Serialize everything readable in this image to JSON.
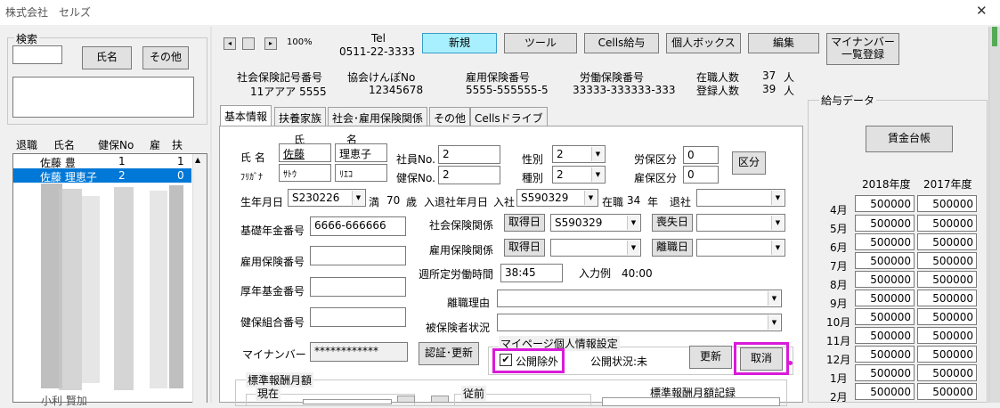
{
  "window": {
    "title": "株式会社　セルズ",
    "close_symbol": "✕"
  },
  "search": {
    "group_title": "検索",
    "input_value": "",
    "name_button": "氏名",
    "other_button": "その他",
    "results_box": ""
  },
  "employee_list": {
    "headers": [
      "退職",
      "氏名",
      "健保No",
      "扶"
    ],
    "header_extra": "雇",
    "rows": [
      {
        "name": "佐藤 豊",
        "no": "1",
        "dep": "1",
        "selected": false
      },
      {
        "name": "佐藤 理恵子",
        "no": "2",
        "dep": "0",
        "selected": true
      }
    ],
    "partial_row": "小利 賢加"
  },
  "nav": {
    "first": "◂",
    "prev": "",
    "next": "▸",
    "zoom": "100%"
  },
  "tel": {
    "label": "Tel",
    "number": "0511-22-3333"
  },
  "toolbar": {
    "new": "新規",
    "tool": "ツール",
    "cells_salary": "Cells給与",
    "personal_box": "個人ボックス",
    "edit": "編集",
    "mynumber_line1": "マイナンバー",
    "mynumber_line2": "一覧登録"
  },
  "info": {
    "social_label": "社会保険記号番号",
    "social_value": "11アアア 5555",
    "kenpo_label": "協会けんぽNo",
    "kenpo_value": "12345678",
    "koyo_label": "雇用保険番号",
    "koyo_value": "5555-555555-5",
    "rodo_label": "労働保険番号",
    "rodo_value": "33333-333333-333",
    "zaishoku_label": "在職人数",
    "zaishoku_value": "37",
    "toroku_label": "登録人数",
    "toroku_value": "39",
    "person_unit": "人"
  },
  "tabs": [
    "基本情報",
    "扶養家族",
    "社会･雇用保険関係",
    "その他",
    "Cellsドライブ"
  ],
  "form": {
    "col_sei": "氏",
    "col_mei": "名",
    "name_label": "氏 名",
    "kana_label": "ﾌﾘｶﾞﾅ",
    "sei": "佐藤",
    "mei": "理恵子",
    "sei_kana": "ｻﾄｳ",
    "mei_kana": "ﾘｴｺ",
    "employee_no_label": "社員No.",
    "employee_no": "2",
    "kenpo_no_label": "健保No.",
    "kenpo_no": "2",
    "sex_label": "性別",
    "sex": "2",
    "type_label": "種別",
    "type": "2",
    "rouho_label": "労保区分",
    "rouho": "0",
    "koho_label": "雇保区分",
    "koho": "0",
    "kubun_button": "区分",
    "birth_label": "生年月日",
    "birth": "S230226",
    "age_prefix": "満",
    "age": "70",
    "age_unit": "歳",
    "join_label": "入退社年月日",
    "join_prefix": "入社",
    "join": "S590329",
    "tenure_prefix": "在職",
    "tenure": "34",
    "tenure_unit": "年",
    "leave_prefix": "退社",
    "leave": "",
    "pension_label": "基礎年金番号",
    "pension": "6666-666666",
    "social_rel_label": "社会保険関係",
    "acquire_button": "取得日",
    "social_acquire": "S590329",
    "lose_button": "喪失日",
    "social_lose": "",
    "koyo_rel_label": "雇用保険関係",
    "koyo_acquire": "",
    "leave_button": "離職日",
    "koyo_leave": "",
    "koyo_no_label": "雇用保険番号",
    "koyo_no": "",
    "weekly_label": "週所定労働時間",
    "weekly": "38:45",
    "example": "入力例　40:00",
    "kosei_label": "厚年基金番号",
    "kosei": "",
    "reason_label": "離職理由",
    "reason": "",
    "kumiai_label": "健保組合番号",
    "kumiai": "",
    "insured_label": "被保険者状況",
    "insured": "",
    "mynumber_label": "マイナンバー",
    "mynumber_value": "************",
    "auth_button": "認証･更新"
  },
  "mypage": {
    "title": "マイページ個人情報設定",
    "checkbox_label": "公開除外",
    "checked": true,
    "status": "公開状況:未",
    "update_button": "更新",
    "cancel_button": "取消"
  },
  "standard": {
    "title": "標準報酬月額",
    "current": "現在",
    "previous": "従前",
    "record": "標準報酬月額記録"
  },
  "salary": {
    "title": "給与データ",
    "ledger_button": "賃金台帳",
    "year1": "2018年度",
    "year2": "2017年度",
    "rows": [
      {
        "month": "4月",
        "v1": "500000",
        "v2": "500000"
      },
      {
        "month": "5月",
        "v1": "500000",
        "v2": "500000"
      },
      {
        "month": "6月",
        "v1": "500000",
        "v2": "500000"
      },
      {
        "month": "7月",
        "v1": "500000",
        "v2": "500000"
      },
      {
        "month": "8月",
        "v1": "500000",
        "v2": "500000"
      },
      {
        "month": "9月",
        "v1": "500000",
        "v2": "500000"
      },
      {
        "month": "10月",
        "v1": "500000",
        "v2": "500000"
      },
      {
        "month": "11月",
        "v1": "500000",
        "v2": "500000"
      },
      {
        "month": "12月",
        "v1": "500000",
        "v2": "500000"
      },
      {
        "month": "1月",
        "v1": "500000",
        "v2": "500000"
      },
      {
        "month": "2月",
        "v1": "500000",
        "v2": "500000"
      }
    ]
  },
  "colors": {
    "highlight": "#d91ad9",
    "selection": "#0078d7",
    "new_button": "#a8f0ff"
  }
}
